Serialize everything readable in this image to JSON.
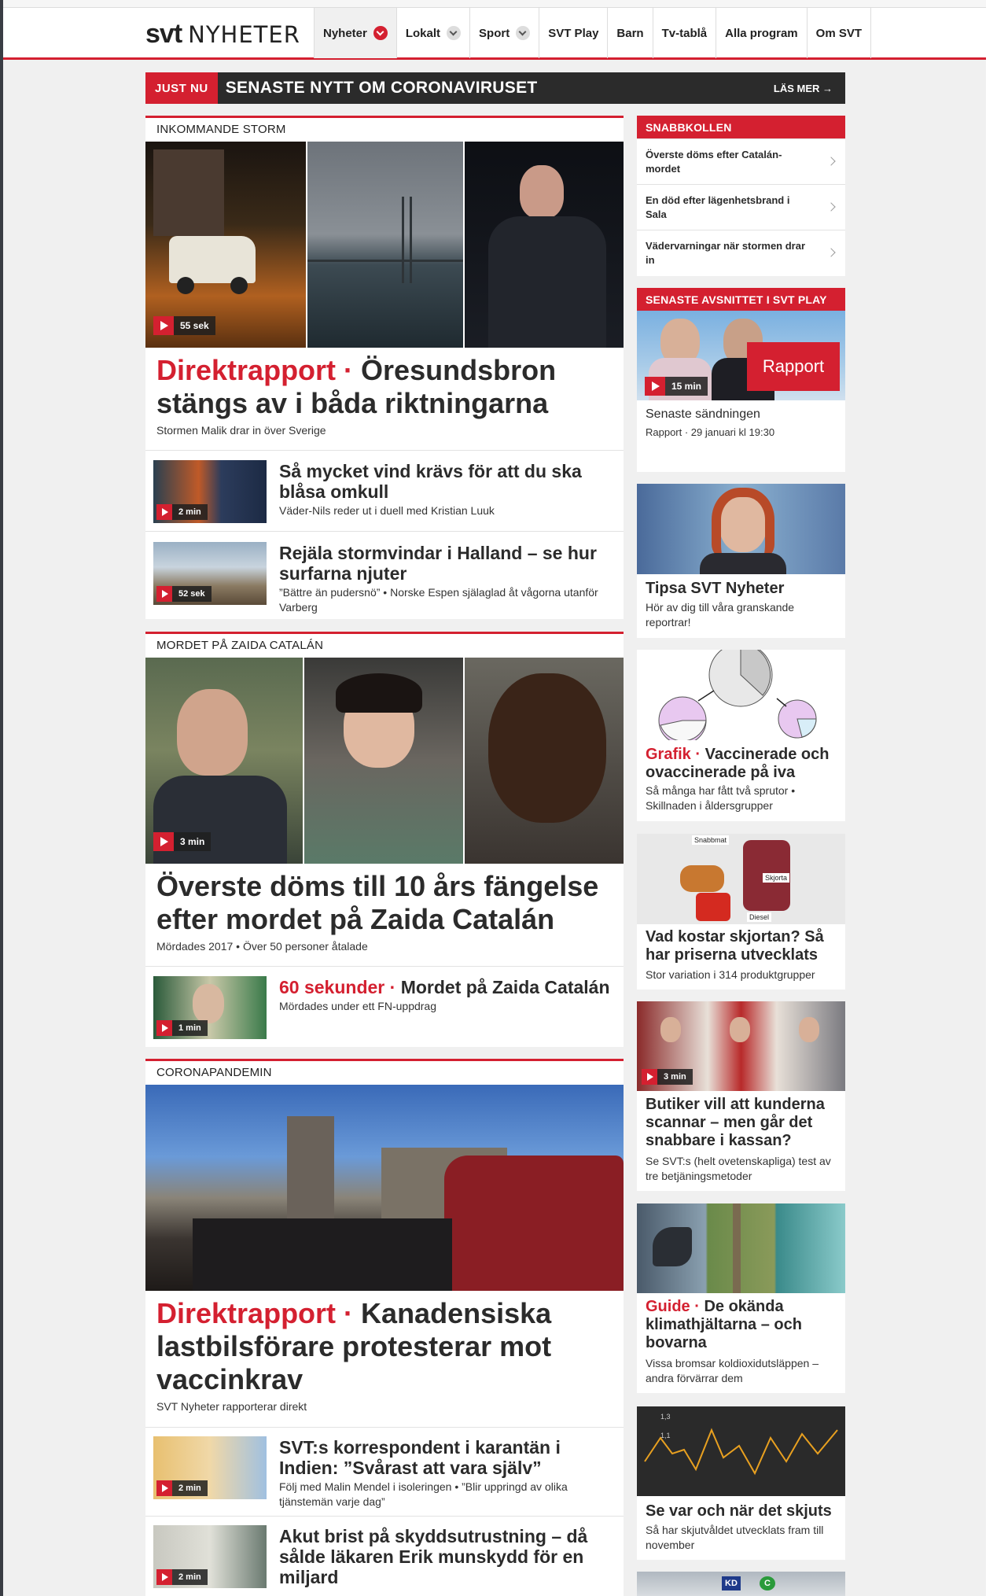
{
  "nav": {
    "logo_svt": "svt",
    "logo_nyheter": "NYHETER",
    "items": [
      {
        "label": "Nyheter"
      },
      {
        "label": "Lokalt"
      },
      {
        "label": "Sport"
      },
      {
        "label": "SVT Play"
      },
      {
        "label": "Barn"
      },
      {
        "label": "Tv-tablå"
      },
      {
        "label": "Alla program"
      },
      {
        "label": "Om SVT"
      }
    ]
  },
  "banner": {
    "tag": "JUST NU",
    "headline": "SENASTE NYTT OM CORONAVIRUSET",
    "more": "LÄS MER →"
  },
  "storm": {
    "label": "INKOMMANDE STORM",
    "video_duration": "55 sek",
    "headline_prefix": "Direktrapport ·",
    "headline": "Öresundsbron stängs av i båda riktningarna",
    "sub": "Stormen Malik drar in över Sverige",
    "items": [
      {
        "duration": "2 min",
        "title": "Så mycket vind krävs för att du ska blåsa omkull",
        "sub": "Väder-Nils reder ut i duell med Kristian Luuk"
      },
      {
        "duration": "52 sek",
        "title": "Rejäla stormvindar i Halland – se hur surfarna njuter",
        "sub": "”Bättre än pudersnö” • Norske Espen själaglad åt vågorna utanför Varberg"
      }
    ]
  },
  "mordet": {
    "label": "MORDET PÅ ZAIDA CATALÁN",
    "video_duration": "3 min",
    "headline": "Överste döms till 10 års fängelse efter mordet på Zaida Catalán",
    "sub": "Mördades 2017 • Över 50 personer åtalade",
    "item": {
      "duration": "1 min",
      "prefix": "60 sekunder ·",
      "title": "Mordet på Zaida Catalán",
      "sub": "Mördades under ett FN-uppdrag"
    }
  },
  "corona": {
    "label": "CORONAPANDEMIN",
    "headline_prefix": "Direktrapport ·",
    "headline": "Kanadensiska lastbilsförare protesterar mot vaccinkrav",
    "sub": "SVT Nyheter rapporterar direkt",
    "items": [
      {
        "duration": "2 min",
        "title": "SVT:s korrespondent i karantän i Indien: ”Svårast att vara själv”",
        "sub": "Följ med Malin Mendel i isoleringen • ”Blir uppringd av olika tjänstemän varje dag”"
      },
      {
        "duration": "2 min",
        "title": "Akut brist på skyddsutrustning – då sålde läkaren Erik munskydd för en miljard",
        "sub": ""
      }
    ]
  },
  "snabbkollen": {
    "header": "SNABBKOLLEN",
    "items": [
      "Överste döms efter Catalán-mordet",
      "En död efter lägenhetsbrand i Sala",
      "Vädervarningar när stormen drar in"
    ]
  },
  "play": {
    "header": "SENASTE AVSNITTET I SVT PLAY",
    "duration": "15 min",
    "badge": "Rapport",
    "title": "Senaste sändningen",
    "meta": "Rapport · 29 januari kl 19:30"
  },
  "tipsa": {
    "title": "Tipsa SVT Nyheter",
    "sub": "Hör av dig till våra granskande reportrar!"
  },
  "grafik": {
    "prefix": "Grafik ·",
    "title": "Vaccinerade och ovaccinerade på iva",
    "sub": "Så många har fått två sprutor • Skillnaden i åldersgrupper"
  },
  "skjorta": {
    "title": "Vad kostar skjortan? Så har priserna utvecklats",
    "sub": "Stor variation i 314 produktgrupper",
    "labels": [
      "Snabbmat",
      "Skjorta",
      "Diesel"
    ]
  },
  "butiker": {
    "duration": "3 min",
    "title": "Butiker vill att kunderna scannar – men går det snabbare i kassan?",
    "sub": "Se SVT:s (helt ovetenskapliga) test av tre betjäningsmetoder"
  },
  "guide": {
    "prefix": "Guide ·",
    "title": "De okända klimathjältarna – och bovarna",
    "sub": "Vissa bromsar koldioxidutsläppen – andra förvärrar dem"
  },
  "skjuts": {
    "title": "Se var och när det skjuts",
    "sub": "Så har skjutvåldet utvecklats fram till november",
    "axis": [
      "1,3",
      "1,1"
    ]
  },
  "last": {
    "badge1": "KD",
    "badge2": "C"
  },
  "colors": {
    "accent": "#d42030",
    "dark": "#2b2b2b",
    "bg": "#f0f0f0"
  }
}
